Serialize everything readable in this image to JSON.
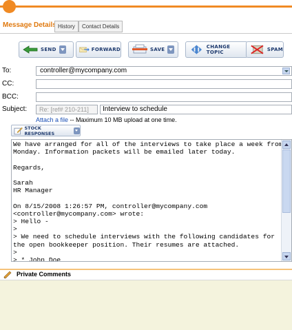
{
  "tabs": {
    "active": "Message Details",
    "others": [
      "History",
      "Contact Details"
    ]
  },
  "toolbar": {
    "send": "SEND",
    "forward": "FORWARD",
    "save": "SAVE",
    "change_topic": "CHANGE TOPIC",
    "spam": "SPAM"
  },
  "fields": {
    "to_label": "To:",
    "to_value": "controller@mycompany.com",
    "cc_label": "CC:",
    "bcc_label": "BCC:",
    "subject_label": "Subject:",
    "subject_ref": "Re: [ref# 210-211]",
    "subject_value": "Interview to schedule"
  },
  "attach": {
    "link": "Attach a file",
    "note": " -- Maximum 10 MB upload at one time."
  },
  "stock_responses": "STOCK RESPONSES",
  "message_body": "We have arranged for all of the interviews to take place a week from\nMonday. Information packets will be emailed later today.\n\nRegards,\n\nSarah\nHR Manager\n\nOn 8/15/2008 1:26:57 PM, controller@mycompany.com\n<controller@mycompany.com> wrote:\n> Hello -\n>\n> We need to schedule interviews with the following candidates for\nthe open bookkeeper position. Their resumes are attached.\n>\n> * John Doe",
  "private_comments": {
    "title": "Private Comments"
  },
  "colors": {
    "accent": "#f08a24",
    "button_text": "#1e3a6e",
    "link": "#1a4fb5",
    "comments_bg": "#f4f3dd"
  }
}
